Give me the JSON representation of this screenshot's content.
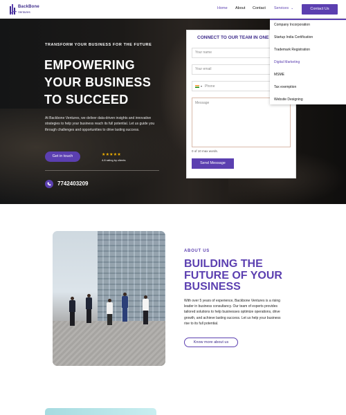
{
  "brand": {
    "name": "BackBone",
    "tagline": "Ventures"
  },
  "nav": {
    "items": [
      "Home",
      "About",
      "Contact"
    ],
    "services_label": "Services",
    "contact_button": "Contact Us"
  },
  "services_menu": {
    "items": [
      "Company Incorporation",
      "Startup India Certification",
      "Trademark Registration",
      "Digital Marketing",
      "MSME",
      "Tax exemption",
      "Website Designing"
    ],
    "active": "Digital Marketing"
  },
  "hero": {
    "tagline": "TRANSFORM YOUR BUSINESS FOR THE FUTURE",
    "title_lines": [
      "EMPOWERING",
      "YOUR BUSINESS",
      "TO SUCCEED"
    ],
    "description": "At Backbone Ventures, we deliver data-driven insights and innovative strategies to help your business reach its full potential. Let us guide you through challenges and opportunities to drive lasting success.",
    "cta": "Get in touch",
    "rating_text": "4.8 rating by clients",
    "rating_value": 4.8,
    "stars": "★★★★★",
    "phone": "7742403209"
  },
  "form": {
    "title": "CONNECT TO OUR TEAM IN ONE",
    "name_placeholder": "Your name",
    "email_placeholder": "Your email",
    "phone_placeholder": "Phone",
    "message_placeholder": "Message",
    "word_count": "0 of 10 max words.",
    "submit": "Send Message"
  },
  "about": {
    "kicker": "ABOUT US",
    "title_lines": [
      "BUILDING THE",
      "FUTURE OF YOUR",
      "BUSINESS"
    ],
    "description": "With over 5 years of experience, Backbone Ventures is a rising leader in business consultancy. Our team of experts provides tailored solutions to help businesses optimize operations, drive growth, and achieve lasting success. Let us help your business rise to its full potential.",
    "button": "Know more about us"
  },
  "colors": {
    "accent": "#5b3fb0",
    "accent_dark": "#3c2a8a",
    "star": "#f5b400"
  }
}
